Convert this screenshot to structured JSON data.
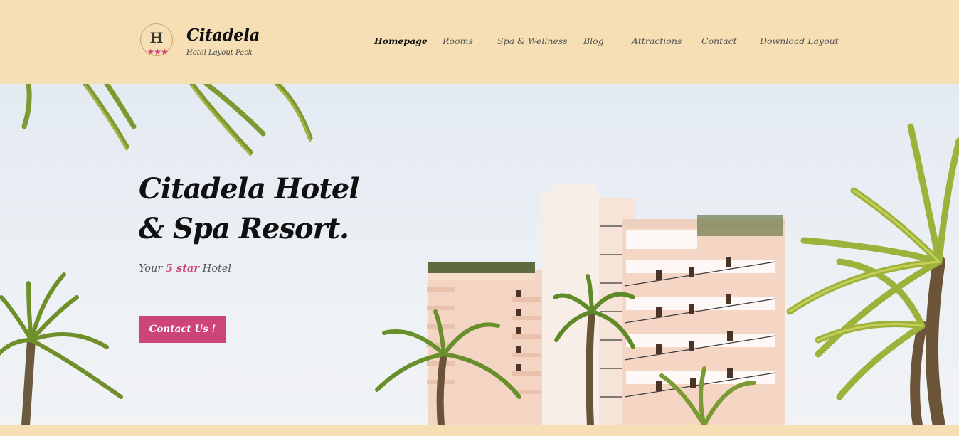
{
  "brand": {
    "logo_letter": "H",
    "logo_stars": "★★★",
    "name": "Citadela",
    "tagline": "Hotel Layout Pack"
  },
  "nav": {
    "items": [
      {
        "label": "Homepage",
        "active": true
      },
      {
        "label": "Rooms"
      },
      {
        "label": "Spa & Wellness"
      },
      {
        "label": "Blog"
      },
      {
        "label": "Attractions"
      },
      {
        "label": "Contact"
      },
      {
        "label": "Download Layout"
      }
    ]
  },
  "hero": {
    "title_line1": "Citadela Hotel",
    "title_line2": "& Spa Resort.",
    "subtitle_prefix": "Your",
    "subtitle_accent": "5 star",
    "subtitle_suffix": "Hotel",
    "cta_label": "Contact Us !"
  },
  "colors": {
    "header_bg": "#f7dfb5",
    "accent": "#cd4478",
    "text_dark": "#111111",
    "building": "#f3d2c0",
    "palm": "#7d9a2e"
  },
  "icons": [
    "hotel-logo-icon",
    "star-icon"
  ]
}
